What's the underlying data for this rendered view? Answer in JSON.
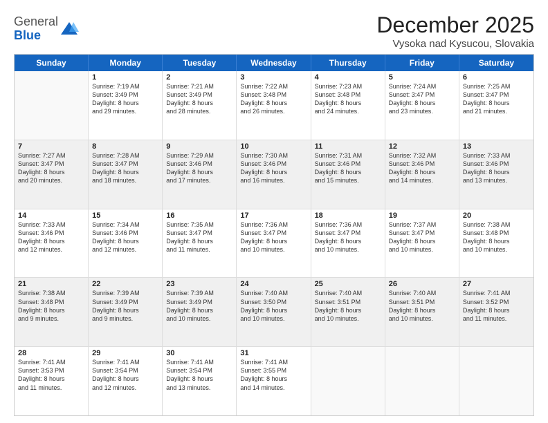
{
  "header": {
    "logo_general": "General",
    "logo_blue": "Blue",
    "title": "December 2025",
    "subtitle": "Vysoka nad Kysucou, Slovakia"
  },
  "days_of_week": [
    "Sunday",
    "Monday",
    "Tuesday",
    "Wednesday",
    "Thursday",
    "Friday",
    "Saturday"
  ],
  "weeks": [
    [
      {
        "day": "",
        "text": "",
        "shaded": false,
        "empty": true
      },
      {
        "day": "1",
        "text": "Sunrise: 7:19 AM\nSunset: 3:49 PM\nDaylight: 8 hours\nand 29 minutes.",
        "shaded": false
      },
      {
        "day": "2",
        "text": "Sunrise: 7:21 AM\nSunset: 3:49 PM\nDaylight: 8 hours\nand 28 minutes.",
        "shaded": false
      },
      {
        "day": "3",
        "text": "Sunrise: 7:22 AM\nSunset: 3:48 PM\nDaylight: 8 hours\nand 26 minutes.",
        "shaded": false
      },
      {
        "day": "4",
        "text": "Sunrise: 7:23 AM\nSunset: 3:48 PM\nDaylight: 8 hours\nand 24 minutes.",
        "shaded": false
      },
      {
        "day": "5",
        "text": "Sunrise: 7:24 AM\nSunset: 3:47 PM\nDaylight: 8 hours\nand 23 minutes.",
        "shaded": false
      },
      {
        "day": "6",
        "text": "Sunrise: 7:25 AM\nSunset: 3:47 PM\nDaylight: 8 hours\nand 21 minutes.",
        "shaded": false
      }
    ],
    [
      {
        "day": "7",
        "text": "Sunrise: 7:27 AM\nSunset: 3:47 PM\nDaylight: 8 hours\nand 20 minutes.",
        "shaded": true
      },
      {
        "day": "8",
        "text": "Sunrise: 7:28 AM\nSunset: 3:47 PM\nDaylight: 8 hours\nand 18 minutes.",
        "shaded": true
      },
      {
        "day": "9",
        "text": "Sunrise: 7:29 AM\nSunset: 3:46 PM\nDaylight: 8 hours\nand 17 minutes.",
        "shaded": true
      },
      {
        "day": "10",
        "text": "Sunrise: 7:30 AM\nSunset: 3:46 PM\nDaylight: 8 hours\nand 16 minutes.",
        "shaded": true
      },
      {
        "day": "11",
        "text": "Sunrise: 7:31 AM\nSunset: 3:46 PM\nDaylight: 8 hours\nand 15 minutes.",
        "shaded": true
      },
      {
        "day": "12",
        "text": "Sunrise: 7:32 AM\nSunset: 3:46 PM\nDaylight: 8 hours\nand 14 minutes.",
        "shaded": true
      },
      {
        "day": "13",
        "text": "Sunrise: 7:33 AM\nSunset: 3:46 PM\nDaylight: 8 hours\nand 13 minutes.",
        "shaded": true
      }
    ],
    [
      {
        "day": "14",
        "text": "Sunrise: 7:33 AM\nSunset: 3:46 PM\nDaylight: 8 hours\nand 12 minutes.",
        "shaded": false
      },
      {
        "day": "15",
        "text": "Sunrise: 7:34 AM\nSunset: 3:46 PM\nDaylight: 8 hours\nand 12 minutes.",
        "shaded": false
      },
      {
        "day": "16",
        "text": "Sunrise: 7:35 AM\nSunset: 3:47 PM\nDaylight: 8 hours\nand 11 minutes.",
        "shaded": false
      },
      {
        "day": "17",
        "text": "Sunrise: 7:36 AM\nSunset: 3:47 PM\nDaylight: 8 hours\nand 10 minutes.",
        "shaded": false
      },
      {
        "day": "18",
        "text": "Sunrise: 7:36 AM\nSunset: 3:47 PM\nDaylight: 8 hours\nand 10 minutes.",
        "shaded": false
      },
      {
        "day": "19",
        "text": "Sunrise: 7:37 AM\nSunset: 3:47 PM\nDaylight: 8 hours\nand 10 minutes.",
        "shaded": false
      },
      {
        "day": "20",
        "text": "Sunrise: 7:38 AM\nSunset: 3:48 PM\nDaylight: 8 hours\nand 10 minutes.",
        "shaded": false
      }
    ],
    [
      {
        "day": "21",
        "text": "Sunrise: 7:38 AM\nSunset: 3:48 PM\nDaylight: 8 hours\nand 9 minutes.",
        "shaded": true
      },
      {
        "day": "22",
        "text": "Sunrise: 7:39 AM\nSunset: 3:49 PM\nDaylight: 8 hours\nand 9 minutes.",
        "shaded": true
      },
      {
        "day": "23",
        "text": "Sunrise: 7:39 AM\nSunset: 3:49 PM\nDaylight: 8 hours\nand 10 minutes.",
        "shaded": true
      },
      {
        "day": "24",
        "text": "Sunrise: 7:40 AM\nSunset: 3:50 PM\nDaylight: 8 hours\nand 10 minutes.",
        "shaded": true
      },
      {
        "day": "25",
        "text": "Sunrise: 7:40 AM\nSunset: 3:51 PM\nDaylight: 8 hours\nand 10 minutes.",
        "shaded": true
      },
      {
        "day": "26",
        "text": "Sunrise: 7:40 AM\nSunset: 3:51 PM\nDaylight: 8 hours\nand 10 minutes.",
        "shaded": true
      },
      {
        "day": "27",
        "text": "Sunrise: 7:41 AM\nSunset: 3:52 PM\nDaylight: 8 hours\nand 11 minutes.",
        "shaded": true
      }
    ],
    [
      {
        "day": "28",
        "text": "Sunrise: 7:41 AM\nSunset: 3:53 PM\nDaylight: 8 hours\nand 11 minutes.",
        "shaded": false
      },
      {
        "day": "29",
        "text": "Sunrise: 7:41 AM\nSunset: 3:54 PM\nDaylight: 8 hours\nand 12 minutes.",
        "shaded": false
      },
      {
        "day": "30",
        "text": "Sunrise: 7:41 AM\nSunset: 3:54 PM\nDaylight: 8 hours\nand 13 minutes.",
        "shaded": false
      },
      {
        "day": "31",
        "text": "Sunrise: 7:41 AM\nSunset: 3:55 PM\nDaylight: 8 hours\nand 14 minutes.",
        "shaded": false
      },
      {
        "day": "",
        "text": "",
        "shaded": false,
        "empty": true
      },
      {
        "day": "",
        "text": "",
        "shaded": false,
        "empty": true
      },
      {
        "day": "",
        "text": "",
        "shaded": false,
        "empty": true
      }
    ]
  ]
}
